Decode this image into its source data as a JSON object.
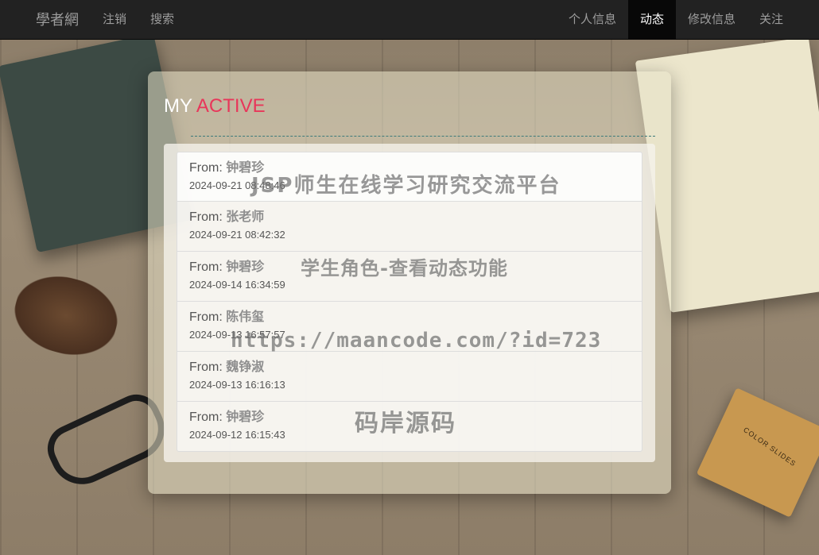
{
  "nav": {
    "brand": "學者網",
    "left_items": [
      {
        "label": "注销"
      },
      {
        "label": "搜索"
      }
    ],
    "right_items": [
      {
        "label": "个人信息"
      },
      {
        "label": "动态",
        "active": true
      },
      {
        "label": "修改信息"
      },
      {
        "label": "关注"
      }
    ]
  },
  "panel": {
    "title_part1": "MY ",
    "title_part2": "ACTIVE",
    "accent_color": "#e8365a"
  },
  "activities": [
    {
      "from_label": "From:",
      "name": "钟碧珍",
      "time": "2024-09-21 08:48:46"
    },
    {
      "from_label": "From:",
      "name": "张老师",
      "time": "2024-09-21 08:42:32"
    },
    {
      "from_label": "From:",
      "name": "钟碧珍",
      "time": "2024-09-14 16:34:59"
    },
    {
      "from_label": "From:",
      "name": "陈伟玺",
      "time": "2024-09-13 16:57:57"
    },
    {
      "from_label": "From:",
      "name": "魏铮淑",
      "time": "2024-09-13 16:16:13"
    },
    {
      "from_label": "From:",
      "name": "钟碧珍",
      "time": "2024-09-12 16:15:43"
    }
  ],
  "background": {
    "box_label": "COLOR SLIDES"
  },
  "watermark": {
    "line1": "JSP师生在线学习研究交流平台",
    "line2": "学生角色-查看动态功能",
    "line3": "https://maancode.com/?id=723",
    "line4": "码岸源码"
  }
}
